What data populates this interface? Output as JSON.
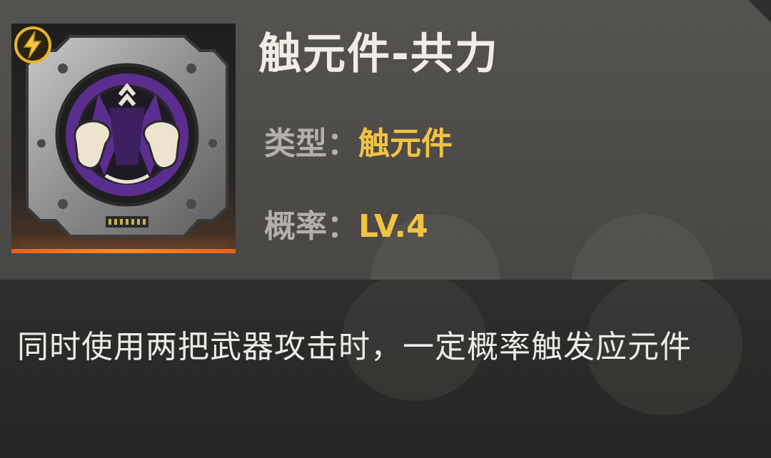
{
  "item": {
    "name": "触元件-共力",
    "type_label": "类型：",
    "type_value": "触元件",
    "probability_label": "概率：",
    "probability_value": "LV.4",
    "description": "同时使用两把武器攻击时，一定概率触发应元件"
  },
  "icons": {
    "badge": "lightning-energy-icon",
    "component": "fists-crossed-component-icon"
  },
  "colors": {
    "accent_yellow": "#f2c343",
    "label_gray": "#b3b0aa",
    "glow_orange": "#ff8a2a",
    "emblem_purple": "#5a2d8f"
  }
}
